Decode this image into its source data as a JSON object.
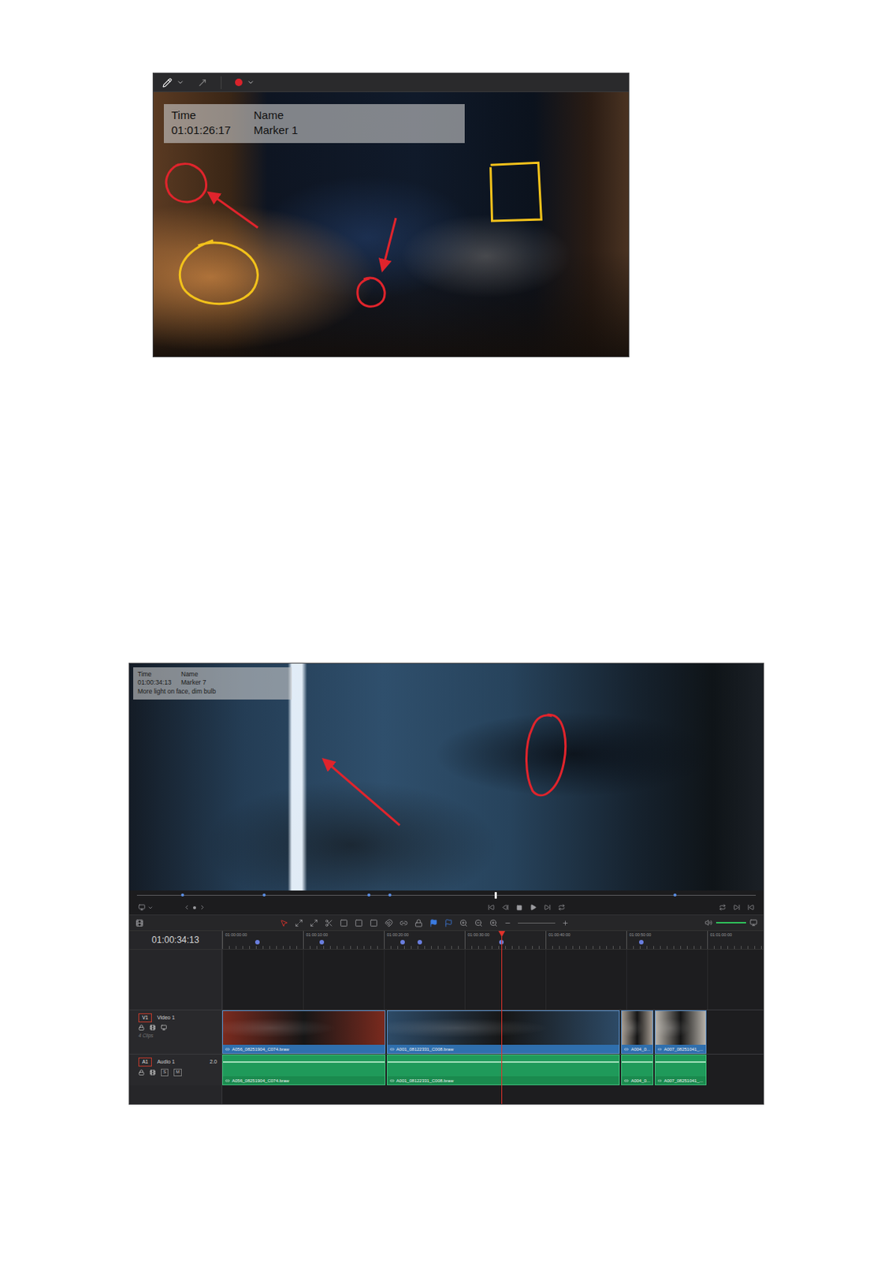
{
  "figure_annotate": {
    "toolbar": {
      "color": "#d9232b"
    },
    "marker": {
      "time_label": "Time",
      "time": "01:01:26:17",
      "name_label": "Name",
      "name": "Marker 1"
    }
  },
  "figure_timeline": {
    "marker": {
      "time_label": "Time",
      "time": "01:00:34:13",
      "name_label": "Name",
      "name": "Marker 7",
      "note": "More light on face, dim bulb"
    },
    "scrubber": {
      "playhead": 0.577,
      "markers": [
        {
          "level": 0.084
        },
        {
          "level": 0.213
        },
        {
          "level": 0.378
        },
        {
          "level": 0.411
        },
        {
          "level": 0.861
        }
      ]
    },
    "timecode": "01:00:34:13",
    "ruler": {
      "ticks": [
        "01:00:00:00",
        "01:00:10:00",
        "01:00:20:00",
        "01:00:30:00",
        "01:00:40:00",
        "01:00:50:00",
        "01:01:00:00"
      ],
      "markers": [
        {
          "level": 0.065
        },
        {
          "level": 0.184
        },
        {
          "level": 0.334
        },
        {
          "level": 0.365
        },
        {
          "level": 0.516
        },
        {
          "level": 0.774
        }
      ],
      "playhead": 0.516
    },
    "video_track": {
      "badge": "V1",
      "name": "Video 1",
      "count": "4 Clips",
      "clips": [
        {
          "name": "A056_08251904_C074.braw",
          "length": 0.301,
          "color": "#7a2a1e"
        },
        {
          "name": "A001_08122331_C008.braw",
          "length": 0.431,
          "color": "#2d4a66"
        },
        {
          "name": "A004_0...",
          "length": 0.059,
          "color": "#a39a90"
        },
        {
          "name": "A007_08251041_...",
          "length": 0.095,
          "color": "#b7b2aa"
        }
      ]
    },
    "audio_track": {
      "badge": "A1",
      "name": "Audio 1",
      "format": "2.0",
      "buttons": [
        "S",
        "M"
      ],
      "clips": [
        {
          "name": "A056_08251904_C074.braw",
          "length": 0.301
        },
        {
          "name": "A001_08122331_C008.braw",
          "length": 0.431
        },
        {
          "name": "A004_0...",
          "length": 0.059
        },
        {
          "name": "A007_08251041_...",
          "length": 0.095
        }
      ]
    }
  }
}
